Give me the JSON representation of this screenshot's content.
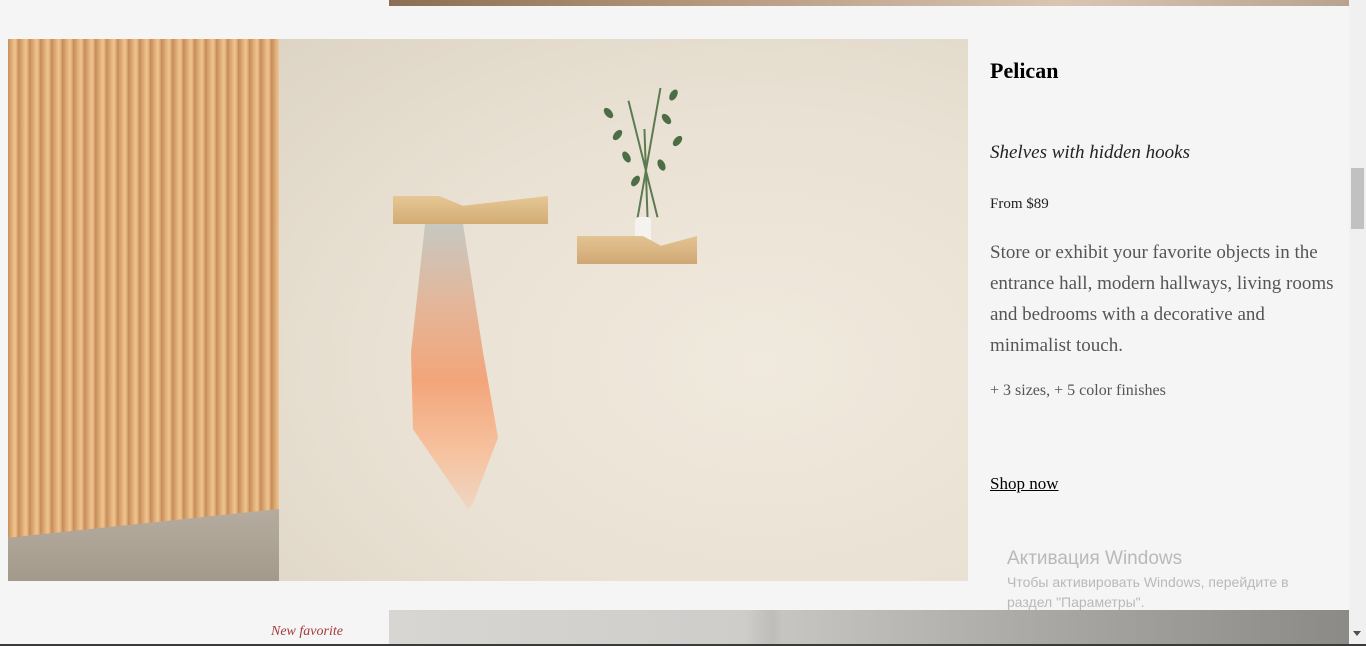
{
  "product": {
    "name": "Pelican",
    "tagline": "Shelves with hidden hooks",
    "price": "From $89",
    "description": "Store or exhibit your favorite objects in the entrance hall, modern hallways, living rooms and bedrooms with a decorative and minimalist touch.",
    "options": "+ 3 sizes, + 5 color finishes",
    "cta": "Shop now"
  },
  "next_product": {
    "label": "New favorite"
  },
  "windows_watermark": {
    "title": "Активация Windows",
    "body": "Чтобы активировать Windows, перейдите в раздел \"Параметры\"."
  },
  "colors": {
    "background": "#f5f5f5",
    "next_label": "#a43a3a",
    "text_muted": "#555555"
  }
}
